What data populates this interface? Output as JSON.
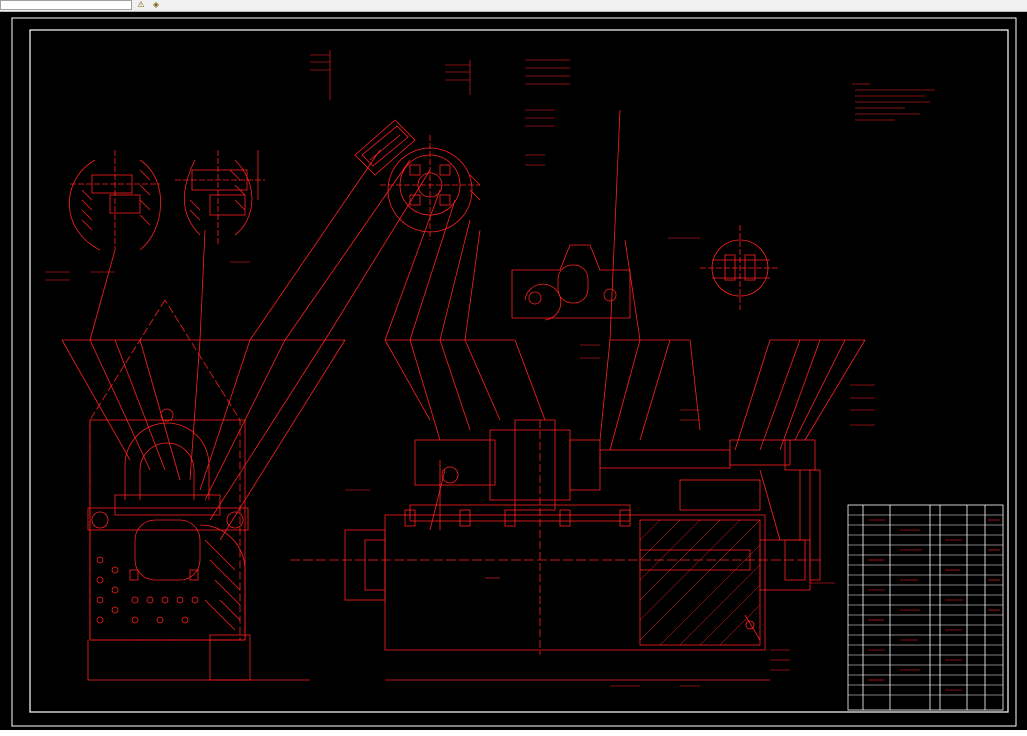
{
  "toolbar": {
    "field_value": "",
    "icons": [
      "warning-icon",
      "layers-icon"
    ]
  },
  "drawing": {
    "line_color": "#ff2020",
    "frame_color": "#ffffff",
    "background": "#000000"
  },
  "status_text": ""
}
